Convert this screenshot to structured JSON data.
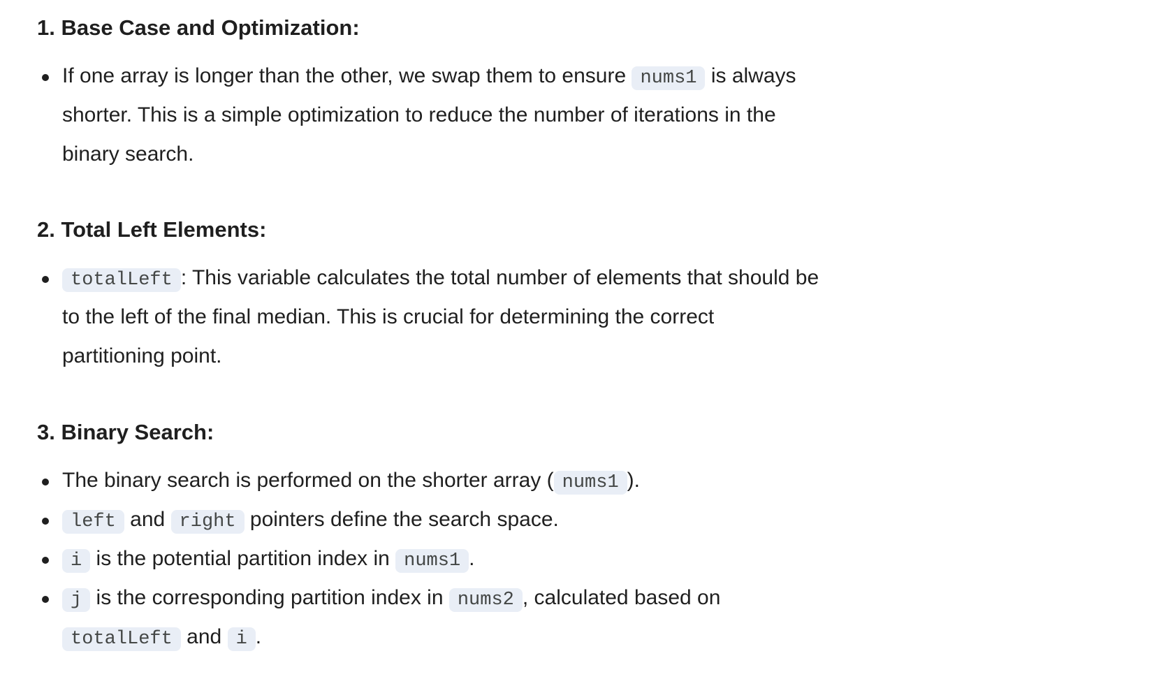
{
  "sections": [
    {
      "heading": "1. Base Case and Optimization:",
      "bullets": [
        {
          "lines": [
            [
              {
                "t": "If one array is longer than the other, we swap them to ensure "
              },
              {
                "t": "nums1",
                "code": true
              },
              {
                "t": " is always"
              }
            ],
            [
              {
                "t": "shorter. This is a simple optimization to reduce the number of iterations in the"
              }
            ],
            [
              {
                "t": "binary search."
              }
            ]
          ]
        }
      ]
    },
    {
      "heading": "2. Total Left Elements:",
      "bullets": [
        {
          "lines": [
            [
              {
                "t": "totalLeft",
                "code": true
              },
              {
                "t": ": This variable calculates the total number of elements that should be"
              }
            ],
            [
              {
                "t": "to the left of the final median. This is crucial for determining the correct"
              }
            ],
            [
              {
                "t": "partitioning point."
              }
            ]
          ]
        }
      ]
    },
    {
      "heading": "3. Binary Search:",
      "bullets": [
        {
          "lines": [
            [
              {
                "t": "The binary search is performed on the shorter array ("
              },
              {
                "t": "nums1",
                "code": true
              },
              {
                "t": ")."
              }
            ]
          ]
        },
        {
          "lines": [
            [
              {
                "t": "left",
                "code": true
              },
              {
                "t": " and "
              },
              {
                "t": "right",
                "code": true
              },
              {
                "t": " pointers define the search space."
              }
            ]
          ]
        },
        {
          "lines": [
            [
              {
                "t": "i",
                "code": true
              },
              {
                "t": " is the potential partition index in "
              },
              {
                "t": "nums1",
                "code": true
              },
              {
                "t": "."
              }
            ]
          ]
        },
        {
          "lines": [
            [
              {
                "t": "j",
                "code": true
              },
              {
                "t": " is the corresponding partition index in "
              },
              {
                "t": "nums2",
                "code": true
              },
              {
                "t": ", calculated based on"
              }
            ],
            [
              {
                "t": "totalLeft",
                "code": true
              },
              {
                "t": " and "
              },
              {
                "t": "i",
                "code": true
              },
              {
                "t": "."
              }
            ]
          ]
        }
      ]
    }
  ]
}
